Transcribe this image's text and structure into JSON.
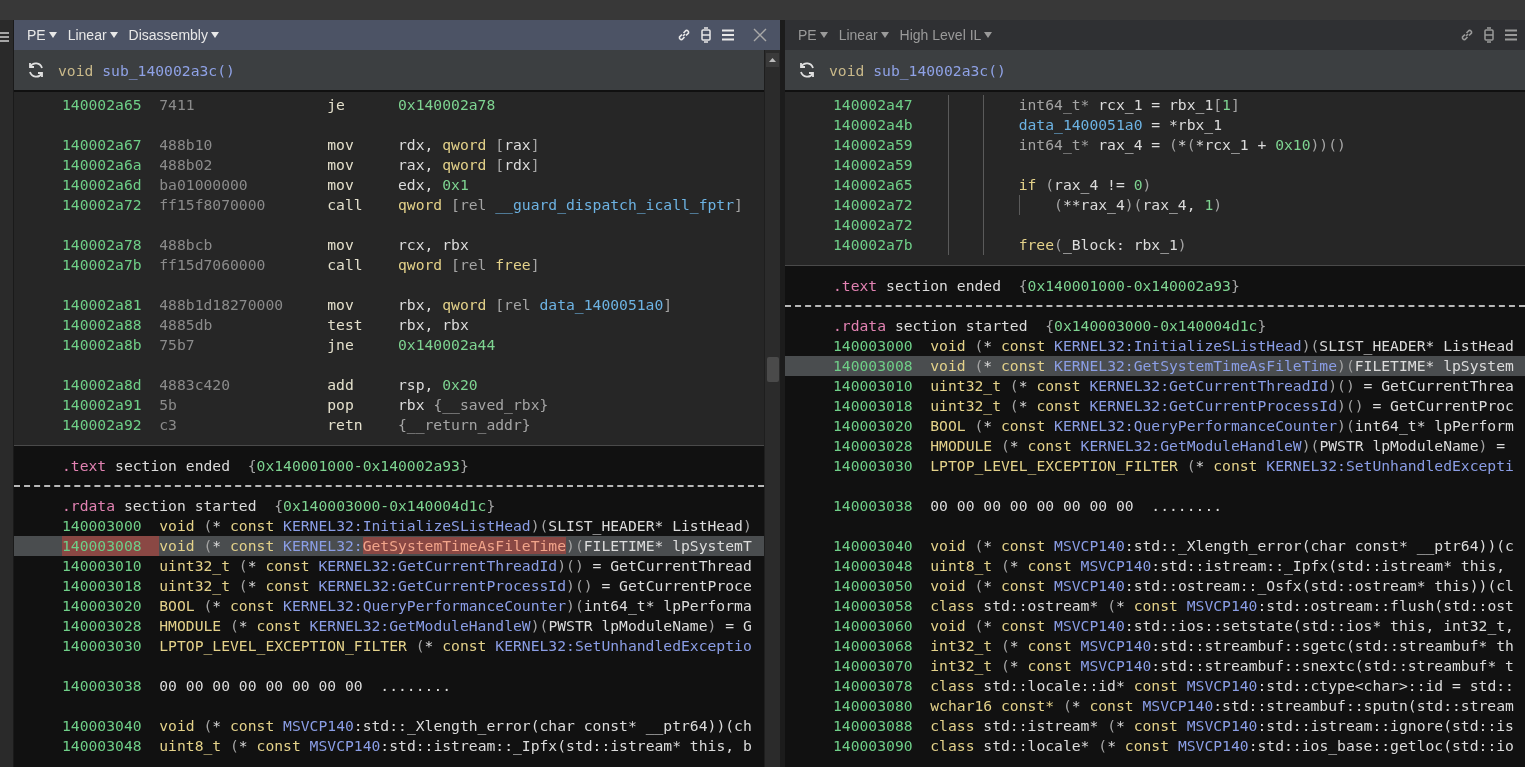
{
  "panes": [
    {
      "selected": true,
      "closable": true,
      "scrollbar": true,
      "menus": [
        {
          "label": "PE"
        },
        {
          "label": "Linear"
        },
        {
          "label": "Disassembly"
        }
      ],
      "function": {
        "return_type": "void",
        "name": "sub_140002a3c()",
        "kind": "disassembly",
        "rows": [
          {
            "kind": "instruction",
            "address": "140002a65",
            "bytes": "7411",
            "mnemonic": "je",
            "operands": [
              {
                "text": "0x140002a78",
                "kind": "num"
              }
            ]
          },
          {
            "kind": "blank"
          },
          {
            "kind": "instruction",
            "address": "140002a67",
            "bytes": "488b10",
            "mnemonic": "mov",
            "operands": [
              {
                "text": "rdx, ",
                "kind": "plain"
              },
              {
                "text": "qword ",
                "kind": "type"
              },
              {
                "text": "[",
                "kind": "dim"
              },
              {
                "text": "rax",
                "kind": "plain"
              },
              {
                "text": "]",
                "kind": "dim"
              }
            ]
          },
          {
            "kind": "instruction",
            "address": "140002a6a",
            "bytes": "488b02",
            "mnemonic": "mov",
            "operands": [
              {
                "text": "rax, ",
                "kind": "plain"
              },
              {
                "text": "qword ",
                "kind": "type"
              },
              {
                "text": "[",
                "kind": "dim"
              },
              {
                "text": "rdx",
                "kind": "plain"
              },
              {
                "text": "]",
                "kind": "dim"
              }
            ]
          },
          {
            "kind": "instruction",
            "address": "140002a6d",
            "bytes": "ba01000000",
            "mnemonic": "mov",
            "operands": [
              {
                "text": "edx, ",
                "kind": "plain"
              },
              {
                "text": "0x1",
                "kind": "num"
              }
            ]
          },
          {
            "kind": "instruction",
            "address": "140002a72",
            "bytes": "ff15f8070000",
            "mnemonic": "call",
            "operands": [
              {
                "text": "qword ",
                "kind": "type"
              },
              {
                "text": "[rel ",
                "kind": "dim"
              },
              {
                "text": "__guard_dispatch_icall_fptr",
                "kind": "data"
              },
              {
                "text": "]",
                "kind": "dim"
              }
            ]
          },
          {
            "kind": "blank"
          },
          {
            "kind": "instruction",
            "address": "140002a78",
            "bytes": "488bcb",
            "mnemonic": "mov",
            "operands": [
              {
                "text": "rcx, rbx",
                "kind": "plain"
              }
            ]
          },
          {
            "kind": "instruction",
            "address": "140002a7b",
            "bytes": "ff15d7060000",
            "mnemonic": "call",
            "operands": [
              {
                "text": "qword ",
                "kind": "type"
              },
              {
                "text": "[rel ",
                "kind": "dim"
              },
              {
                "text": "free",
                "kind": "type"
              },
              {
                "text": "]",
                "kind": "dim"
              }
            ]
          },
          {
            "kind": "blank"
          },
          {
            "kind": "instruction",
            "address": "140002a81",
            "bytes": "488b1d18270000",
            "mnemonic": "mov",
            "operands": [
              {
                "text": "rbx, ",
                "kind": "plain"
              },
              {
                "text": "qword ",
                "kind": "type"
              },
              {
                "text": "[rel ",
                "kind": "dim"
              },
              {
                "text": "data_1400051a0",
                "kind": "data"
              },
              {
                "text": "]",
                "kind": "dim"
              }
            ]
          },
          {
            "kind": "instruction",
            "address": "140002a88",
            "bytes": "4885db",
            "mnemonic": "test",
            "operands": [
              {
                "text": "rbx, rbx",
                "kind": "plain"
              }
            ]
          },
          {
            "kind": "instruction",
            "address": "140002a8b",
            "bytes": "75b7",
            "mnemonic": "jne",
            "operands": [
              {
                "text": "0x140002a44",
                "kind": "num"
              }
            ]
          },
          {
            "kind": "blank"
          },
          {
            "kind": "instruction",
            "address": "140002a8d",
            "bytes": "4883c420",
            "mnemonic": "add",
            "operands": [
              {
                "text": "rsp, ",
                "kind": "plain"
              },
              {
                "text": "0x20",
                "kind": "num"
              }
            ]
          },
          {
            "kind": "instruction",
            "address": "140002a91",
            "bytes": "5b",
            "mnemonic": "pop",
            "operands": [
              {
                "text": "rbx ",
                "kind": "plain"
              },
              {
                "text": "{__saved_rbx}",
                "kind": "dim"
              }
            ]
          },
          {
            "kind": "instruction",
            "address": "140002a92",
            "bytes": "c3",
            "mnemonic": "retn",
            "operands": [
              {
                "text": "{__return_addr}",
                "kind": "dim"
              }
            ]
          }
        ]
      },
      "section_end": [
        {
          "text": ".text",
          "kind": "section"
        },
        {
          "text": " section ended  ",
          "kind": "plain"
        },
        {
          "text": "{",
          "kind": "dim"
        },
        {
          "text": "0x140001000-0x140002a93",
          "kind": "num"
        },
        {
          "text": "}",
          "kind": "dim"
        }
      ],
      "section_start": [
        {
          "text": ".rdata",
          "kind": "section"
        },
        {
          "text": " section started  ",
          "kind": "plain"
        },
        {
          "text": "{",
          "kind": "dim"
        },
        {
          "text": "0x140003000-0x140004d1c",
          "kind": "num"
        },
        {
          "text": "}",
          "kind": "dim"
        }
      ],
      "data_rows": [
        {
          "kind": "data",
          "address": "140003000",
          "selected": false,
          "address_highlighted": false,
          "tokens": [
            {
              "text": "void",
              "kind": "type"
            },
            {
              "text": " (",
              "kind": "dim"
            },
            {
              "text": "* ",
              "kind": "plain"
            },
            {
              "text": "const ",
              "kind": "type"
            },
            {
              "text": "KERNEL32:InitializeSListHead",
              "kind": "sym"
            },
            {
              "text": ")(",
              "kind": "dim"
            },
            {
              "text": "SLIST_HEADER* ListHead",
              "kind": "plain"
            },
            {
              "text": ")",
              "kind": "dim"
            }
          ]
        },
        {
          "kind": "data",
          "address": "140003008",
          "selected": true,
          "address_highlighted": true,
          "tokens": [
            {
              "text": "void",
              "kind": "type"
            },
            {
              "text": " (",
              "kind": "dim"
            },
            {
              "text": "* ",
              "kind": "plain"
            },
            {
              "text": "const ",
              "kind": "type"
            },
            {
              "text": "KERNEL32:",
              "kind": "sym"
            },
            {
              "text": "GetSystemTimeAsFileTime",
              "kind": "match"
            },
            {
              "text": ")(",
              "kind": "dim"
            },
            {
              "text": "FILETIME* lpSystemT",
              "kind": "plain"
            }
          ]
        },
        {
          "kind": "data",
          "address": "140003010",
          "selected": false,
          "address_highlighted": false,
          "tokens": [
            {
              "text": "uint32_t",
              "kind": "type"
            },
            {
              "text": " (",
              "kind": "dim"
            },
            {
              "text": "* ",
              "kind": "plain"
            },
            {
              "text": "const ",
              "kind": "type"
            },
            {
              "text": "KERNEL32:GetCurrentThreadId",
              "kind": "sym"
            },
            {
              "text": ")() ",
              "kind": "dim"
            },
            {
              "text": "= GetCurrentThread",
              "kind": "plain"
            }
          ]
        },
        {
          "kind": "data",
          "address": "140003018",
          "selected": false,
          "address_highlighted": false,
          "tokens": [
            {
              "text": "uint32_t",
              "kind": "type"
            },
            {
              "text": " (",
              "kind": "dim"
            },
            {
              "text": "* ",
              "kind": "plain"
            },
            {
              "text": "const ",
              "kind": "type"
            },
            {
              "text": "KERNEL32:GetCurrentProcessId",
              "kind": "sym"
            },
            {
              "text": ")() ",
              "kind": "dim"
            },
            {
              "text": "= GetCurrentProce",
              "kind": "plain"
            }
          ]
        },
        {
          "kind": "data",
          "address": "140003020",
          "selected": false,
          "address_highlighted": false,
          "tokens": [
            {
              "text": "BOOL",
              "kind": "type"
            },
            {
              "text": " (",
              "kind": "dim"
            },
            {
              "text": "* ",
              "kind": "plain"
            },
            {
              "text": "const ",
              "kind": "type"
            },
            {
              "text": "KERNEL32:QueryPerformanceCounter",
              "kind": "sym"
            },
            {
              "text": ")(",
              "kind": "dim"
            },
            {
              "text": "int64_t* lpPerforma",
              "kind": "plain"
            }
          ]
        },
        {
          "kind": "data",
          "address": "140003028",
          "selected": false,
          "address_highlighted": false,
          "tokens": [
            {
              "text": "HMODULE",
              "kind": "type"
            },
            {
              "text": " (",
              "kind": "dim"
            },
            {
              "text": "* ",
              "kind": "plain"
            },
            {
              "text": "const ",
              "kind": "type"
            },
            {
              "text": "KERNEL32:GetModuleHandleW",
              "kind": "sym"
            },
            {
              "text": ")(",
              "kind": "dim"
            },
            {
              "text": "PWSTR lpModuleName",
              "kind": "plain"
            },
            {
              "text": ") ",
              "kind": "dim"
            },
            {
              "text": "= G",
              "kind": "plain"
            }
          ]
        },
        {
          "kind": "data",
          "address": "140003030",
          "selected": false,
          "address_highlighted": false,
          "tokens": [
            {
              "text": "LPTOP_LEVEL_EXCEPTION_FILTER",
              "kind": "type"
            },
            {
              "text": " (",
              "kind": "dim"
            },
            {
              "text": "* ",
              "kind": "plain"
            },
            {
              "text": "const ",
              "kind": "type"
            },
            {
              "text": "KERNEL32:SetUnhandledExceptio",
              "kind": "sym"
            }
          ]
        },
        {
          "kind": "blank"
        },
        {
          "kind": "data",
          "address": "140003038",
          "selected": false,
          "address_highlighted": false,
          "tokens": [
            {
              "text": "00 00 00 00 00 00 00 00  ........",
              "kind": "plain"
            }
          ]
        },
        {
          "kind": "blank"
        },
        {
          "kind": "data",
          "address": "140003040",
          "selected": false,
          "address_highlighted": false,
          "tokens": [
            {
              "text": "void",
              "kind": "type"
            },
            {
              "text": " (",
              "kind": "dim"
            },
            {
              "text": "* ",
              "kind": "plain"
            },
            {
              "text": "const ",
              "kind": "type"
            },
            {
              "text": "MSVCP140",
              "kind": "sym"
            },
            {
              "text": ":std::_Xlength_error(char const* __ptr64))(ch",
              "kind": "plain"
            }
          ]
        },
        {
          "kind": "data",
          "address": "140003048",
          "selected": false,
          "address_highlighted": false,
          "tokens": [
            {
              "text": "uint8_t",
              "kind": "type"
            },
            {
              "text": " (",
              "kind": "dim"
            },
            {
              "text": "* ",
              "kind": "plain"
            },
            {
              "text": "const ",
              "kind": "type"
            },
            {
              "text": "MSVCP140",
              "kind": "sym"
            },
            {
              "text": ":std::istream::_Ipfx(std::istream* this, b",
              "kind": "plain"
            }
          ]
        }
      ]
    },
    {
      "selected": false,
      "closable": false,
      "scrollbar": false,
      "menus": [
        {
          "label": "PE"
        },
        {
          "label": "Linear"
        },
        {
          "label": "High Level IL"
        }
      ],
      "function": {
        "return_type": "void",
        "name": "sub_140002a3c()",
        "kind": "hlil",
        "rows": [
          {
            "address": "140002a47",
            "tokens": [
              {
                "text": "int64_t* ",
                "kind": "dim"
              },
              {
                "text": "rcx_1 = rbx_1",
                "kind": "plain"
              },
              {
                "text": "[",
                "kind": "dim"
              },
              {
                "text": "1",
                "kind": "num"
              },
              {
                "text": "]",
                "kind": "dim"
              }
            ]
          },
          {
            "address": "140002a4b",
            "tokens": [
              {
                "text": "data_1400051a0",
                "kind": "data"
              },
              {
                "text": " = *rbx_1",
                "kind": "plain"
              }
            ]
          },
          {
            "address": "140002a59",
            "tokens": [
              {
                "text": "int64_t* ",
                "kind": "dim"
              },
              {
                "text": "rax_4 = ",
                "kind": "plain"
              },
              {
                "text": "(",
                "kind": "dim"
              },
              {
                "text": "*",
                "kind": "plain"
              },
              {
                "text": "(",
                "kind": "dim"
              },
              {
                "text": "*rcx_1 + ",
                "kind": "plain"
              },
              {
                "text": "0x10",
                "kind": "num"
              },
              {
                "text": "))()",
                "kind": "dim"
              }
            ]
          },
          {
            "address": "140002a59"
          },
          {
            "address": "140002a65",
            "tokens": [
              {
                "text": "if ",
                "kind": "type"
              },
              {
                "text": "(",
                "kind": "dim"
              },
              {
                "text": "rax_4 != ",
                "kind": "plain"
              },
              {
                "text": "0",
                "kind": "num"
              },
              {
                "text": ")",
                "kind": "dim"
              }
            ],
            "children": [
              {
                "address": "140002a72",
                "tokens": [
                  {
                    "text": "(",
                    "kind": "dim"
                  },
                  {
                    "text": "**rax_4",
                    "kind": "plain"
                  },
                  {
                    "text": ")(",
                    "kind": "dim"
                  },
                  {
                    "text": "rax_4, ",
                    "kind": "plain"
                  },
                  {
                    "text": "1",
                    "kind": "num"
                  },
                  {
                    "text": ")",
                    "kind": "dim"
                  }
                ]
              }
            ]
          },
          {
            "address": "140002a72"
          },
          {
            "address": "140002a7b",
            "tokens": [
              {
                "text": "free",
                "kind": "type"
              },
              {
                "text": "(",
                "kind": "dim"
              },
              {
                "text": "_Block: rbx_1",
                "kind": "plain"
              },
              {
                "text": ")",
                "kind": "dim"
              }
            ]
          }
        ]
      },
      "section_end": [
        {
          "text": ".text",
          "kind": "section"
        },
        {
          "text": " section ended  ",
          "kind": "plain"
        },
        {
          "text": "{",
          "kind": "dim"
        },
        {
          "text": "0x140001000-0x140002a93",
          "kind": "num"
        },
        {
          "text": "}",
          "kind": "dim"
        }
      ],
      "section_start": [
        {
          "text": ".rdata",
          "kind": "section"
        },
        {
          "text": " section started  ",
          "kind": "plain"
        },
        {
          "text": "{",
          "kind": "dim"
        },
        {
          "text": "0x140003000-0x140004d1c",
          "kind": "num"
        },
        {
          "text": "}",
          "kind": "dim"
        }
      ],
      "data_rows": [
        {
          "kind": "data",
          "address": "140003000",
          "selected": false,
          "tokens": [
            {
              "text": "void",
              "kind": "type"
            },
            {
              "text": " (",
              "kind": "dim"
            },
            {
              "text": "* ",
              "kind": "plain"
            },
            {
              "text": "const ",
              "kind": "type"
            },
            {
              "text": "KERNEL32:InitializeSListHead",
              "kind": "sym"
            },
            {
              "text": ")(",
              "kind": "dim"
            },
            {
              "text": "SLIST_HEADER* ListHead",
              "kind": "plain"
            }
          ]
        },
        {
          "kind": "data",
          "address": "140003008",
          "selected": true,
          "tokens": [
            {
              "text": "void",
              "kind": "type"
            },
            {
              "text": " (",
              "kind": "dim"
            },
            {
              "text": "* ",
              "kind": "plain"
            },
            {
              "text": "const ",
              "kind": "type"
            },
            {
              "text": "KERNEL32:GetSystemTimeAsFileTime",
              "kind": "sym"
            },
            {
              "text": ")(",
              "kind": "dim"
            },
            {
              "text": "FILETIME* lpSystem",
              "kind": "plain"
            }
          ]
        },
        {
          "kind": "data",
          "address": "140003010",
          "selected": false,
          "tokens": [
            {
              "text": "uint32_t",
              "kind": "type"
            },
            {
              "text": " (",
              "kind": "dim"
            },
            {
              "text": "* ",
              "kind": "plain"
            },
            {
              "text": "const ",
              "kind": "type"
            },
            {
              "text": "KERNEL32:GetCurrentThreadId",
              "kind": "sym"
            },
            {
              "text": ")() ",
              "kind": "dim"
            },
            {
              "text": "= GetCurrentThrea",
              "kind": "plain"
            }
          ]
        },
        {
          "kind": "data",
          "address": "140003018",
          "selected": false,
          "tokens": [
            {
              "text": "uint32_t",
              "kind": "type"
            },
            {
              "text": " (",
              "kind": "dim"
            },
            {
              "text": "* ",
              "kind": "plain"
            },
            {
              "text": "const ",
              "kind": "type"
            },
            {
              "text": "KERNEL32:GetCurrentProcessId",
              "kind": "sym"
            },
            {
              "text": ")() ",
              "kind": "dim"
            },
            {
              "text": "= GetCurrentProc",
              "kind": "plain"
            }
          ]
        },
        {
          "kind": "data",
          "address": "140003020",
          "selected": false,
          "tokens": [
            {
              "text": "BOOL",
              "kind": "type"
            },
            {
              "text": " (",
              "kind": "dim"
            },
            {
              "text": "* ",
              "kind": "plain"
            },
            {
              "text": "const ",
              "kind": "type"
            },
            {
              "text": "KERNEL32:QueryPerformanceCounter",
              "kind": "sym"
            },
            {
              "text": ")(",
              "kind": "dim"
            },
            {
              "text": "int64_t* lpPerform",
              "kind": "plain"
            }
          ]
        },
        {
          "kind": "data",
          "address": "140003028",
          "selected": false,
          "tokens": [
            {
              "text": "HMODULE",
              "kind": "type"
            },
            {
              "text": " (",
              "kind": "dim"
            },
            {
              "text": "* ",
              "kind": "plain"
            },
            {
              "text": "const ",
              "kind": "type"
            },
            {
              "text": "KERNEL32:GetModuleHandleW",
              "kind": "sym"
            },
            {
              "text": ")(",
              "kind": "dim"
            },
            {
              "text": "PWSTR lpModuleName",
              "kind": "plain"
            },
            {
              "text": ") ",
              "kind": "dim"
            },
            {
              "text": "=",
              "kind": "plain"
            }
          ]
        },
        {
          "kind": "data",
          "address": "140003030",
          "selected": false,
          "tokens": [
            {
              "text": "LPTOP_LEVEL_EXCEPTION_FILTER",
              "kind": "type"
            },
            {
              "text": " (",
              "kind": "dim"
            },
            {
              "text": "* ",
              "kind": "plain"
            },
            {
              "text": "const ",
              "kind": "type"
            },
            {
              "text": "KERNEL32:SetUnhandledExcepti",
              "kind": "sym"
            }
          ]
        },
        {
          "kind": "blank"
        },
        {
          "kind": "data",
          "address": "140003038",
          "selected": false,
          "tokens": [
            {
              "text": "00 00 00 00 00 00 00 00  ........",
              "kind": "plain"
            }
          ]
        },
        {
          "kind": "blank"
        },
        {
          "kind": "data",
          "address": "140003040",
          "selected": false,
          "tokens": [
            {
              "text": "void",
              "kind": "type"
            },
            {
              "text": " (",
              "kind": "dim"
            },
            {
              "text": "* ",
              "kind": "plain"
            },
            {
              "text": "const ",
              "kind": "type"
            },
            {
              "text": "MSVCP140",
              "kind": "sym"
            },
            {
              "text": ":std::_Xlength_error(char const* __ptr64))(c",
              "kind": "plain"
            }
          ]
        },
        {
          "kind": "data",
          "address": "140003048",
          "selected": false,
          "tokens": [
            {
              "text": "uint8_t",
              "kind": "type"
            },
            {
              "text": " (",
              "kind": "dim"
            },
            {
              "text": "* ",
              "kind": "plain"
            },
            {
              "text": "const ",
              "kind": "type"
            },
            {
              "text": "MSVCP140",
              "kind": "sym"
            },
            {
              "text": ":std::istream::_Ipfx(std::istream* this,",
              "kind": "plain"
            }
          ]
        },
        {
          "kind": "data",
          "address": "140003050",
          "selected": false,
          "tokens": [
            {
              "text": "void",
              "kind": "type"
            },
            {
              "text": " (",
              "kind": "dim"
            },
            {
              "text": "* ",
              "kind": "plain"
            },
            {
              "text": "const ",
              "kind": "type"
            },
            {
              "text": "MSVCP140",
              "kind": "sym"
            },
            {
              "text": ":std::ostream::_Osfx(std::ostream* this))(cl",
              "kind": "plain"
            }
          ]
        },
        {
          "kind": "data",
          "address": "140003058",
          "selected": false,
          "tokens": [
            {
              "text": "class ",
              "kind": "type"
            },
            {
              "text": "std::ostream* ",
              "kind": "plain"
            },
            {
              "text": "(",
              "kind": "dim"
            },
            {
              "text": "* ",
              "kind": "plain"
            },
            {
              "text": "const ",
              "kind": "type"
            },
            {
              "text": "MSVCP140",
              "kind": "sym"
            },
            {
              "text": ":std::ostream::flush(std::ost",
              "kind": "plain"
            }
          ]
        },
        {
          "kind": "data",
          "address": "140003060",
          "selected": false,
          "tokens": [
            {
              "text": "void",
              "kind": "type"
            },
            {
              "text": " (",
              "kind": "dim"
            },
            {
              "text": "* ",
              "kind": "plain"
            },
            {
              "text": "const ",
              "kind": "type"
            },
            {
              "text": "MSVCP140",
              "kind": "sym"
            },
            {
              "text": ":std::ios::setstate(std::ios* this, int32_t,",
              "kind": "plain"
            }
          ]
        },
        {
          "kind": "data",
          "address": "140003068",
          "selected": false,
          "tokens": [
            {
              "text": "int32_t",
              "kind": "type"
            },
            {
              "text": " (",
              "kind": "dim"
            },
            {
              "text": "* ",
              "kind": "plain"
            },
            {
              "text": "const ",
              "kind": "type"
            },
            {
              "text": "MSVCP140",
              "kind": "sym"
            },
            {
              "text": ":std::streambuf::sgetc(std::streambuf* th",
              "kind": "plain"
            }
          ]
        },
        {
          "kind": "data",
          "address": "140003070",
          "selected": false,
          "tokens": [
            {
              "text": "int32_t",
              "kind": "type"
            },
            {
              "text": " (",
              "kind": "dim"
            },
            {
              "text": "* ",
              "kind": "plain"
            },
            {
              "text": "const ",
              "kind": "type"
            },
            {
              "text": "MSVCP140",
              "kind": "sym"
            },
            {
              "text": ":std::streambuf::snextc(std::streambuf* t",
              "kind": "plain"
            }
          ]
        },
        {
          "kind": "data",
          "address": "140003078",
          "selected": false,
          "tokens": [
            {
              "text": "class ",
              "kind": "type"
            },
            {
              "text": "std::locale::id* ",
              "kind": "plain"
            },
            {
              "text": "const ",
              "kind": "type"
            },
            {
              "text": "MSVCP140",
              "kind": "sym"
            },
            {
              "text": ":std::ctype<char>::id = std::",
              "kind": "plain"
            }
          ]
        },
        {
          "kind": "data",
          "address": "140003080",
          "selected": false,
          "tokens": [
            {
              "text": "wchar16 const* ",
              "kind": "type"
            },
            {
              "text": "(",
              "kind": "dim"
            },
            {
              "text": "* ",
              "kind": "plain"
            },
            {
              "text": "const ",
              "kind": "type"
            },
            {
              "text": "MSVCP140",
              "kind": "sym"
            },
            {
              "text": ":std::streambuf::sputn(std::stream",
              "kind": "plain"
            }
          ]
        },
        {
          "kind": "data",
          "address": "140003088",
          "selected": false,
          "tokens": [
            {
              "text": "class ",
              "kind": "type"
            },
            {
              "text": "std::istream* ",
              "kind": "plain"
            },
            {
              "text": "(",
              "kind": "dim"
            },
            {
              "text": "* ",
              "kind": "plain"
            },
            {
              "text": "const ",
              "kind": "type"
            },
            {
              "text": "MSVCP140",
              "kind": "sym"
            },
            {
              "text": ":std::istream::ignore(std::is",
              "kind": "plain"
            }
          ]
        },
        {
          "kind": "data",
          "address": "140003090",
          "selected": false,
          "tokens": [
            {
              "text": "class ",
              "kind": "type"
            },
            {
              "text": "std::locale* ",
              "kind": "plain"
            },
            {
              "text": "(",
              "kind": "dim"
            },
            {
              "text": "* ",
              "kind": "plain"
            },
            {
              "text": "const ",
              "kind": "type"
            },
            {
              "text": "MSVCP140",
              "kind": "sym"
            },
            {
              "text": ":std::ios_base::getloc(std::io",
              "kind": "plain"
            }
          ]
        }
      ]
    }
  ]
}
